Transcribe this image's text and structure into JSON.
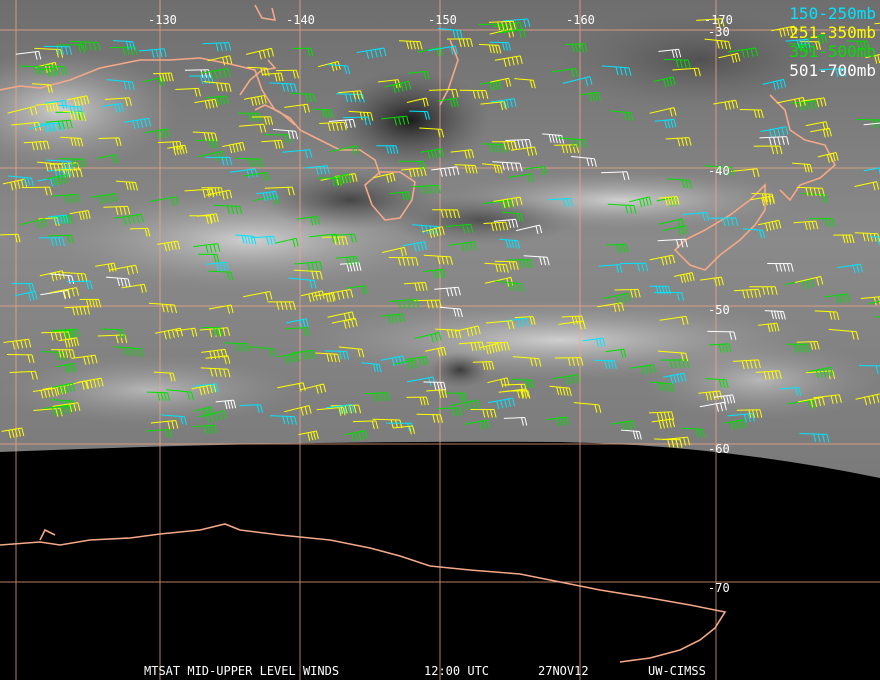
{
  "map": {
    "lon_labels": [
      "-130",
      "-140",
      "-150",
      "-160",
      "-170"
    ],
    "lat_labels": [
      "-30",
      "-40",
      "-50",
      "-60",
      "-70"
    ],
    "colors": {
      "grid": "#f4a888",
      "coast": "#f4a888",
      "earth_bg": "#000000"
    }
  },
  "legend": [
    {
      "label": "150-250mb",
      "color": "#00e5ff"
    },
    {
      "label": "251-350mb",
      "color": "#ffff00"
    },
    {
      "label": "351-500mb",
      "color": "#00e000"
    },
    {
      "label": "501-700mb",
      "color": "#ffffff"
    }
  ],
  "footer": {
    "title": "MTSAT MID-UPPER LEVEL WINDS",
    "time": "12:00 UTC",
    "date": "27NOV12",
    "source": "UW-CIMSS"
  }
}
